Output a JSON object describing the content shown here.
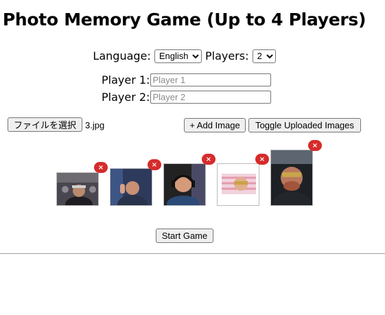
{
  "title": "Photo Memory Game (Up to 4 Players)",
  "settings": {
    "language_label": "Language:",
    "language_value": "English",
    "players_label": "Players:",
    "players_value": "2"
  },
  "players": [
    {
      "label": "Player 1:",
      "placeholder": "Player 1"
    },
    {
      "label": "Player 2:",
      "placeholder": "Player 2"
    }
  ],
  "upload": {
    "choose_file_label": "ファイルを選択",
    "file_name": "3.jpg",
    "add_image_label": "+ Add Image",
    "toggle_label": "Toggle Uploaded Images"
  },
  "thumbnails": {
    "remove_symbol": "×",
    "count": 5,
    "icon": "remove-x-icon",
    "remove_color": "#d62b2b"
  },
  "start_button_label": "Start Game"
}
